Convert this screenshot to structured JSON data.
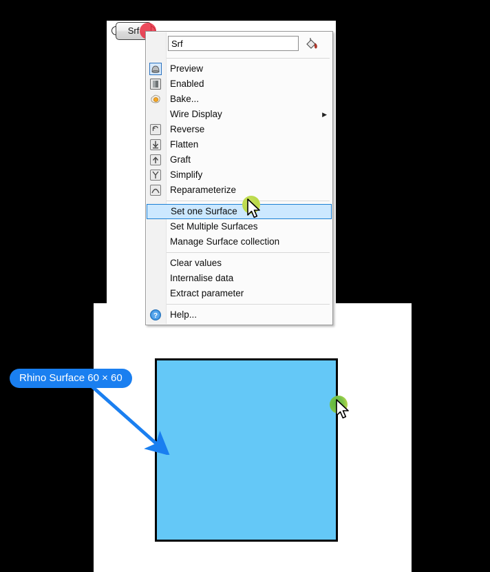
{
  "component": {
    "label": "Srf",
    "input_port_name": "input-port",
    "output_port_name": "output-port",
    "marker_color": "#e9263a"
  },
  "context_menu": {
    "name_field": {
      "value": "Srf",
      "placeholder": "Srf"
    },
    "paint_icon": "paint-bucket-icon",
    "items": [
      {
        "label": "Preview",
        "icon": "preview-icon",
        "type": "item",
        "checked": true
      },
      {
        "label": "Enabled",
        "icon": "enabled-icon",
        "type": "item"
      },
      {
        "label": "Bake...",
        "icon": "bake-icon",
        "type": "item"
      },
      {
        "label": "Wire Display",
        "icon": "none",
        "type": "submenu",
        "arrow": "▶"
      },
      {
        "label": "Reverse",
        "icon": "reverse-icon",
        "type": "item"
      },
      {
        "label": "Flatten",
        "icon": "flatten-icon",
        "type": "item"
      },
      {
        "label": "Graft",
        "icon": "graft-icon",
        "type": "item"
      },
      {
        "label": "Simplify",
        "icon": "simplify-icon",
        "type": "item"
      },
      {
        "label": "Reparameterize",
        "icon": "reparameterize-icon",
        "type": "item"
      },
      {
        "label": "Set one Surface",
        "icon": "none",
        "type": "item",
        "highlighted": true
      },
      {
        "label": "Set Multiple Surfaces",
        "icon": "none",
        "type": "item"
      },
      {
        "label": "Manage Surface collection",
        "icon": "none",
        "type": "item"
      },
      {
        "label": "Clear values",
        "icon": "none",
        "type": "item"
      },
      {
        "label": "Internalise data",
        "icon": "none",
        "type": "item"
      },
      {
        "label": "Extract parameter",
        "icon": "none",
        "type": "item"
      },
      {
        "label": "Help...",
        "icon": "help-icon",
        "type": "item"
      }
    ]
  },
  "annotation": {
    "callout_text": "Rhino Surface 60 × 60",
    "callout_color": "#1a7ff0",
    "arrow_color": "#1a7ff0"
  },
  "viewport": {
    "surface_fill": "#64c8f7",
    "surface_stroke": "#000000"
  },
  "cursors": {
    "menu_cursor": "arrow-cursor",
    "canvas_cursor": "arrow-cursor"
  }
}
